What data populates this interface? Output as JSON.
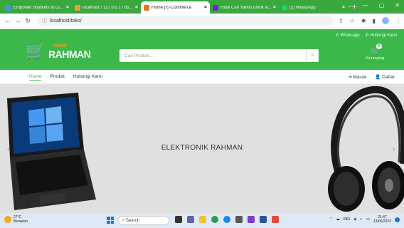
{
  "browser": {
    "tabs": [
      {
        "title": "Empower Students to Di...",
        "favicon_color": "#4a90d9",
        "active": false
      },
      {
        "title": "localhost / 127.0.0.1 / db...",
        "favicon_color": "#f0a030",
        "active": false
      },
      {
        "title": "Home | E-Commerce",
        "favicon_color": "#e8712b",
        "active": true
      },
      {
        "title": "Hasil Cari Yahoo untuk w...",
        "favicon_color": "#6a2fbf",
        "active": false
      },
      {
        "title": "(2) WhatsApp",
        "favicon_color": "#25d366",
        "active": false
      }
    ],
    "url": "localhost/toko/"
  },
  "header": {
    "whatsapp_label": "Whatsapp",
    "contact_label": "Hubungi Kami",
    "brand_small": "TOKO",
    "brand_big": "RAHMAN",
    "search_placeholder": "Cari Produk....",
    "cart_count": "0",
    "cart_label": "Keranjang",
    "accent_color": "#3cb84a",
    "logo_color": "#f3a520"
  },
  "nav": {
    "items": [
      "Home",
      "Produk",
      "Hubungi Kami"
    ],
    "login_label": "Masuk",
    "register_label": "Daftar"
  },
  "hero": {
    "title": "ELEKTRONIK RAHMAN"
  },
  "taskbar": {
    "temperature": "27°C",
    "weather": "Berawan",
    "search_label": "Search",
    "language": "IND",
    "time": "21:47",
    "date": "13/06/2023"
  }
}
